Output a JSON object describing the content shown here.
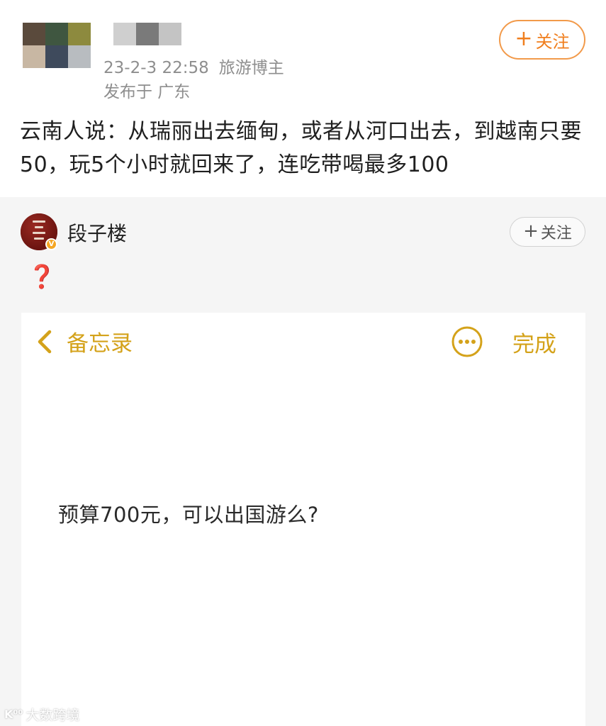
{
  "post": {
    "timestamp": "23-2-3 22:58",
    "author_tag": "旅游博主",
    "location": "发布于 广东",
    "follow_label": "关注",
    "follow_plus": "+",
    "text": "云南人说：从瑞丽出去缅甸，或者从河口出去，到越南只要50，玩5个小时就回来了，连吃带喝最多100"
  },
  "repost": {
    "author_name": "段子楼",
    "verified_badge": "V",
    "follow_label": "关注",
    "follow_plus": "+",
    "caption": "❓"
  },
  "notes_screenshot": {
    "back_label": "备忘录",
    "done_label": "完成",
    "body_text": "预算700元，可以出国游么?"
  },
  "watermark": {
    "logo": "K⁰⁰",
    "text": "大数跨境"
  },
  "colors": {
    "follow_orange": "#f07e1d",
    "notes_accent": "#d4a21a",
    "question_red": "#d0211c",
    "repost_bg": "#f5f5f5",
    "meta_grey": "#8e8e8e"
  },
  "icons": {
    "back": "chevron-left-icon",
    "more": "ellipsis-circle-icon",
    "badge": "verified-v-icon"
  }
}
